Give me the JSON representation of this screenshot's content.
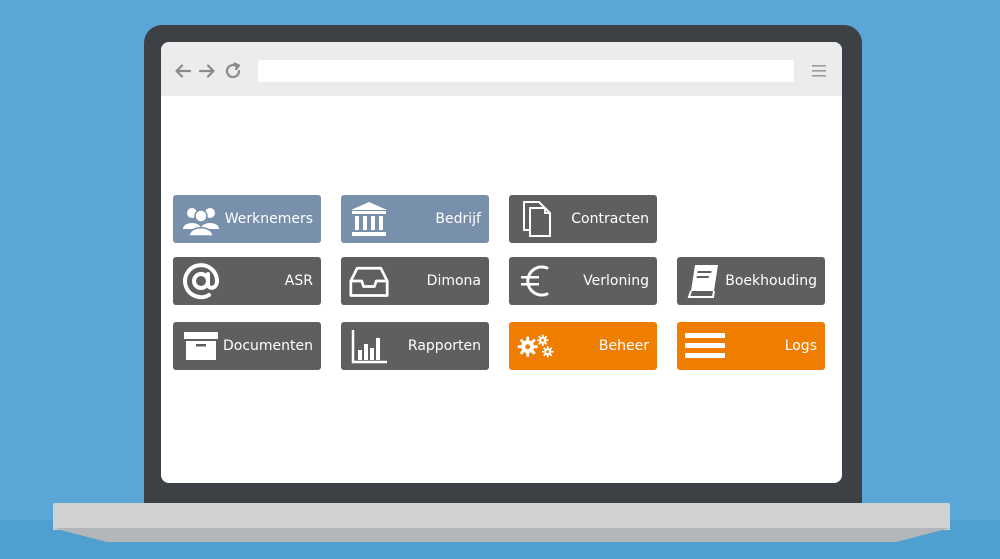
{
  "colors": {
    "background": "#5aa6d6",
    "tile_blue": "#7890ab",
    "tile_gray": "#5f5f5f",
    "tile_orange": "#ef7d00"
  },
  "browser": {
    "address_value": "",
    "back_icon": "arrow-left-icon",
    "forward_icon": "arrow-right-icon",
    "reload_icon": "reload-icon",
    "menu_icon": "hamburger-menu-icon"
  },
  "tiles": [
    {
      "label": "Werknemers",
      "icon": "users-icon",
      "color": "#7890ab"
    },
    {
      "label": "Bedrijf",
      "icon": "bank-icon",
      "color": "#7890ab"
    },
    {
      "label": "Contracten",
      "icon": "documents-icon",
      "color": "#5f5f5f"
    },
    {
      "label": "ASR",
      "icon": "at-sign-icon",
      "color": "#5f5f5f"
    },
    {
      "label": "Dimona",
      "icon": "inbox-icon",
      "color": "#5f5f5f"
    },
    {
      "label": "Verloning",
      "icon": "euro-icon",
      "color": "#5f5f5f"
    },
    {
      "label": "Boekhouding",
      "icon": "book-icon",
      "color": "#5f5f5f"
    },
    {
      "label": "Documenten",
      "icon": "archive-box-icon",
      "color": "#5f5f5f"
    },
    {
      "label": "Rapporten",
      "icon": "bar-chart-icon",
      "color": "#5f5f5f"
    },
    {
      "label": "Beheer",
      "icon": "gears-icon",
      "color": "#ef7d00"
    },
    {
      "label": "Logs",
      "icon": "list-lines-icon",
      "color": "#ef7d00"
    }
  ]
}
